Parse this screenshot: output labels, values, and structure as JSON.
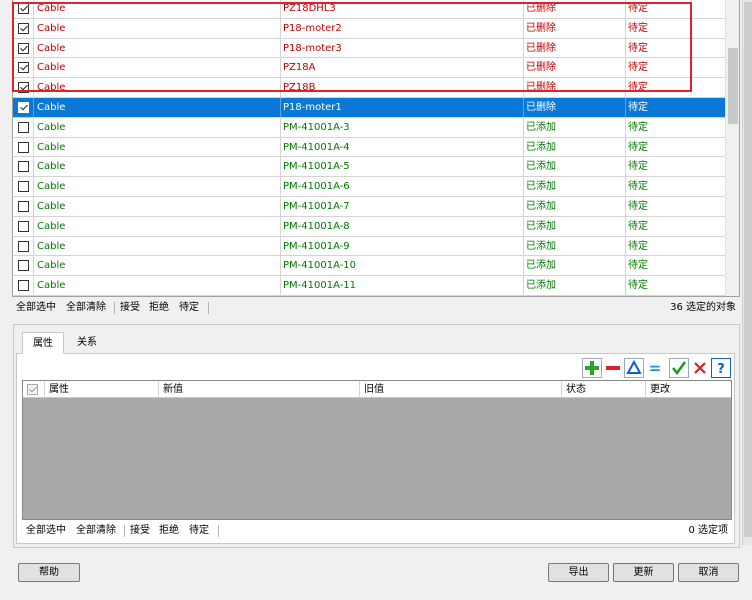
{
  "top_table": {
    "rows": [
      {
        "checked": true,
        "type": "Cable",
        "name": "PZ18DHL3",
        "state": "已删除",
        "action": "待定",
        "kind": "deleted"
      },
      {
        "checked": true,
        "type": "Cable",
        "name": "P18-moter2",
        "state": "已删除",
        "action": "待定",
        "kind": "deleted"
      },
      {
        "checked": true,
        "type": "Cable",
        "name": "P18-moter3",
        "state": "已删除",
        "action": "待定",
        "kind": "deleted"
      },
      {
        "checked": true,
        "type": "Cable",
        "name": "PZ18A",
        "state": "已删除",
        "action": "待定",
        "kind": "deleted"
      },
      {
        "checked": true,
        "type": "Cable",
        "name": "PZ18B",
        "state": "已删除",
        "action": "待定",
        "kind": "deleted"
      },
      {
        "checked": true,
        "type": "Cable",
        "name": "P18-moter1",
        "state": "已删除",
        "action": "待定",
        "kind": "selected"
      },
      {
        "checked": false,
        "type": "Cable",
        "name": "PM-41001A-3",
        "state": "已添加",
        "action": "待定",
        "kind": "added"
      },
      {
        "checked": false,
        "type": "Cable",
        "name": "PM-41001A-4",
        "state": "已添加",
        "action": "待定",
        "kind": "added"
      },
      {
        "checked": false,
        "type": "Cable",
        "name": "PM-41001A-5",
        "state": "已添加",
        "action": "待定",
        "kind": "added"
      },
      {
        "checked": false,
        "type": "Cable",
        "name": "PM-41001A-6",
        "state": "已添加",
        "action": "待定",
        "kind": "added"
      },
      {
        "checked": false,
        "type": "Cable",
        "name": "PM-41001A-7",
        "state": "已添加",
        "action": "待定",
        "kind": "added"
      },
      {
        "checked": false,
        "type": "Cable",
        "name": "PM-41001A-8",
        "state": "已添加",
        "action": "待定",
        "kind": "added"
      },
      {
        "checked": false,
        "type": "Cable",
        "name": "PM-41001A-9",
        "state": "已添加",
        "action": "待定",
        "kind": "added"
      },
      {
        "checked": false,
        "type": "Cable",
        "name": "PM-41001A-10",
        "state": "已添加",
        "action": "待定",
        "kind": "added"
      },
      {
        "checked": false,
        "type": "Cable",
        "name": "PM-41001A-11",
        "state": "已添加",
        "action": "待定",
        "kind": "added"
      }
    ],
    "highlight_color": "#e0202a",
    "selected_color": "#0a78d7",
    "deleted_color": "#c00000",
    "added_color": "#007a00"
  },
  "top_bar": {
    "select_all": "全部选中",
    "clear_all": "全部清除",
    "accept": "接受",
    "reject": "拒绝",
    "pending": "待定",
    "count": "36 选定的对象"
  },
  "tabs": [
    {
      "label": "属性",
      "active": true
    },
    {
      "label": "关系",
      "active": false
    }
  ],
  "toolbar": {
    "icons": [
      "add-icon",
      "remove-icon",
      "modify-icon",
      "equal-icon",
      "accept-icon",
      "reject-icon",
      "help-icon"
    ],
    "equal_glyph": "=",
    "help_glyph": "?"
  },
  "props_grid": {
    "headers": {
      "property": "属性",
      "new_value": "新值",
      "old_value": "旧值",
      "state": "状态",
      "change": "更改"
    }
  },
  "bottom_bar": {
    "select_all": "全部选中",
    "clear_all": "全部清除",
    "accept": "接受",
    "reject": "拒绝",
    "pending": "待定",
    "count": "0 选定项"
  },
  "buttons": {
    "help": "帮助",
    "export": "导出",
    "update": "更新",
    "cancel": "取消"
  }
}
